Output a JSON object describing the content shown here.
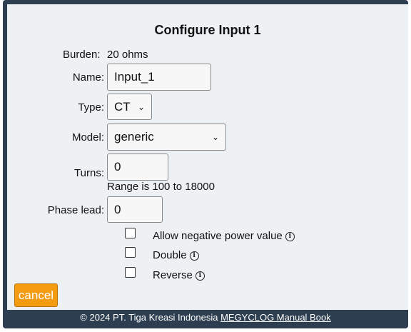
{
  "dialog": {
    "title": "Configure Input 1"
  },
  "form": {
    "burden_label": "Burden:",
    "burden_value": "20 ohms",
    "name_label": "Name:",
    "name_value": "Input_1",
    "type_label": "Type:",
    "type_value": "CT",
    "model_label": "Model:",
    "model_value": "generic",
    "turns_label": "Turns:",
    "turns_value": "0",
    "turns_hint": "Range is 100 to 18000",
    "phase_label": "Phase lead:",
    "phase_value": "0"
  },
  "options": {
    "allow_negative": "Allow negative power value",
    "double": "Double",
    "reverse": "Reverse"
  },
  "buttons": {
    "cancel": "cancel"
  },
  "footer": {
    "copyright": "© 2024 PT. Tiga Kreasi Indonesia",
    "manual_link": "MEGYCLOG Manual Book"
  },
  "colors": {
    "frame": "#2c3e50",
    "panel": "#edf1f3",
    "cancel_button": "#f39c12"
  }
}
